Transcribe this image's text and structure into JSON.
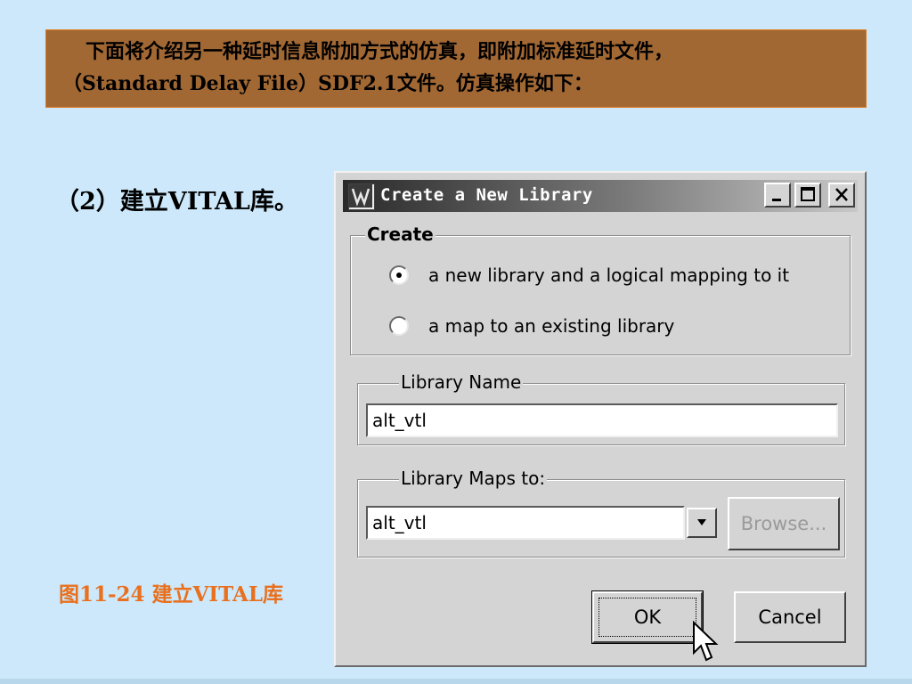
{
  "slide": {
    "intro_line1": "下面将介绍另一种延时信息附加方式的仿真，即附加标准延时文件，",
    "intro_line2": "（Standard Delay File）SDF2.1文件。仿真操作如下：",
    "step": "（2）建立VITAL库。",
    "caption": "图11-24  建立VITAL库"
  },
  "dialog": {
    "title": "Create a New Library",
    "controls": {
      "minimize_icon": "minimize-icon",
      "maximize_icon": "maximize-icon",
      "close_icon": "close-icon"
    },
    "create_group": {
      "legend": "Create",
      "options": [
        {
          "label": "a new library and a logical mapping to it",
          "checked": true
        },
        {
          "label": "a map to an existing library",
          "checked": false
        }
      ]
    },
    "library_name": {
      "legend": "Library Name",
      "value": "alt_vtl"
    },
    "library_maps": {
      "legend": "Library Maps to:",
      "value": "alt_vtl",
      "browse_label": "Browse..."
    },
    "buttons": {
      "ok": "OK",
      "cancel": "Cancel"
    }
  },
  "colors": {
    "banner_bg": "#a26834",
    "page_bg": "#cce8fa",
    "caption": "#e8701e"
  }
}
